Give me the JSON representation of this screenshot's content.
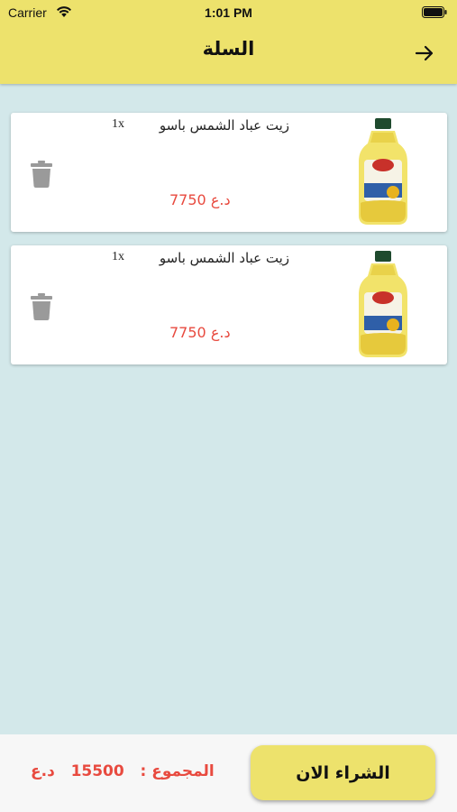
{
  "status_bar": {
    "carrier": "Carrier",
    "time": "1:01 PM"
  },
  "header": {
    "title": "السلة"
  },
  "cart": {
    "items": [
      {
        "name": "زيت عباد الشمس باسو",
        "quantity": "1x",
        "price": "7750 د.ع"
      },
      {
        "name": "زيت عباد الشمس باسو",
        "quantity": "1x",
        "price": "7750 د.ع"
      }
    ]
  },
  "footer": {
    "buy_label": "الشراء الان",
    "total_label": "المجموع :",
    "total_value": "15500",
    "total_currency": "د.ع"
  },
  "colors": {
    "accent": "#ede26c",
    "price": "#e84a3f",
    "background": "#d3e8ea"
  },
  "icons": [
    "wifi-icon",
    "battery-icon",
    "arrow-right-icon",
    "trash-icon",
    "oil-bottle-image"
  ]
}
